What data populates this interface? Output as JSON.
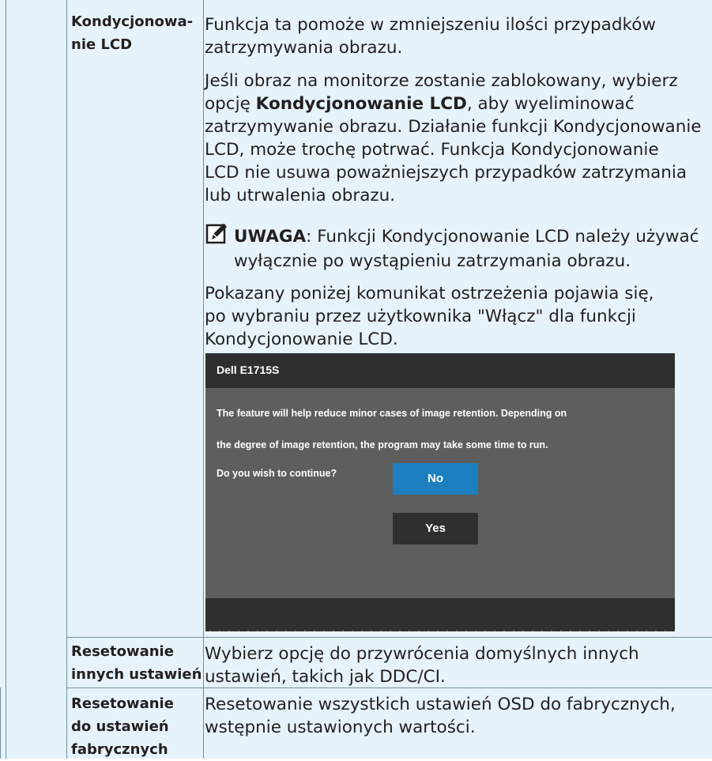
{
  "rows": [
    {
      "label_lines": [
        "Kondycjonowa-",
        "nie LCD"
      ],
      "paragraphs": {
        "p1_lines": [
          "Funkcja ta pomoże w zmniejszeniu ilości przypadków",
          "zatrzymywania obrazu."
        ],
        "p2_line1_prefix": "Jeśli obraz na monitorze zostanie zablokowany, wybierz",
        "p2_line2_pre": "opcję ",
        "p2_line2_bold": "Kondycjonowanie LCD",
        "p2_line2_post": ", aby wyeliminować",
        "p2_rest_lines": [
          "zatrzymywanie obrazu. Działanie funkcji Kondycjonowanie",
          "LCD, może trochę potrwać. Funkcja Kondycjonowanie",
          "LCD nie usuwa poważniejszych przypadków zatrzymania",
          "lub utrwalenia obrazu."
        ],
        "note_label": "UWAGA",
        "note_text": ": Funkcji Kondycjonowanie LCD należy używać",
        "note_cont": "wyłącznie po wystąpieniu zatrzymania obrazu.",
        "p3_lines": [
          "Pokazany poniżej komunikat ostrzeżenia pojawia się,",
          "po wybraniu przez użytkownika \"Włącz\" dla funkcji",
          "Kondycjonowanie LCD."
        ]
      },
      "dialog": {
        "title": "Dell E1715S",
        "message_lines": [
          "The feature will help reduce minor cases of image retention. Depending on",
          "the degree of image retention, the program may take some time to run.",
          "Do you wish to continue?"
        ],
        "no_label": "No",
        "yes_label": "Yes"
      }
    },
    {
      "label_lines": [
        "Resetowanie",
        "innych ustawień"
      ],
      "desc_lines": [
        "Wybierz opcję do przywrócenia domyślnych innych",
        "ustawień, takich jak DDC/CI."
      ]
    },
    {
      "label_lines": [
        "Resetowanie",
        "do ustawień",
        "fabrycznych"
      ],
      "desc_lines": [
        "Resetowanie wszystkich ustawień OSD do fabrycznych,",
        "wstępnie ustawionych wartości."
      ]
    }
  ],
  "colors": {
    "cell_background": "#e6f3fb",
    "grid_line": "#6e8fa3",
    "dialog_body": "#5e5e5e",
    "dialog_bar": "#2f2f2f",
    "button_selected": "#1d7fbf"
  },
  "icons": {
    "note": "pencil-note-icon"
  }
}
